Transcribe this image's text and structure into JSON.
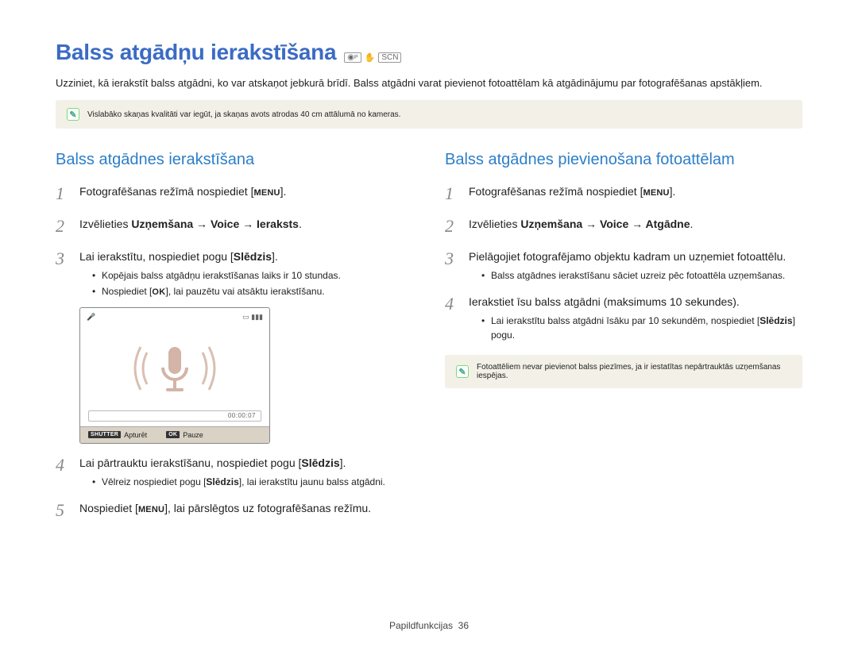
{
  "title": "Balss atgādņu ierakstīšana",
  "title_icons": {
    "p": "P",
    "hand": "✋",
    "scn": "SCN"
  },
  "intro": "Uzziniet, kā ierakstīt balss atgādni, ko var atskaņot jebkurā brīdī. Balss atgādni varat pievienot fotoattēlam kā atgādinājumu par fotografēšanas apstākļiem.",
  "tip1": "Vislabāko skaņas kvalitāti var iegūt, ja skaņas avots atrodas 40 cm attālumā no kameras.",
  "left": {
    "title": "Balss atgādnes ierakstīšana",
    "steps": {
      "s1_pre": "Fotografēšanas režīmā nospiediet [",
      "s1_menu": "MENU",
      "s1_post": "].",
      "s2_pre": "Izvēlieties ",
      "s2_bold": "Uzņemšana → Voice → Ieraksts",
      "s2_post": ".",
      "s3": "Lai ierakstītu, nospiediet pogu [",
      "s3_bold": "Slēdzis",
      "s3_post": "].",
      "s3_sub1": "Kopējais balss atgādņu ierakstīšanas laiks ir 10 stundas.",
      "s3_sub2_pre": "Nospiediet [",
      "s3_sub2_ok": "OK",
      "s3_sub2_post": "], lai pauzētu vai atsāktu ierakstīšanu.",
      "s4": "Lai pārtrauktu ierakstīšanu, nospiediet pogu [",
      "s4_bold": "Slēdzis",
      "s4_post": "].",
      "s4_sub_pre": "Vēlreiz nospiediet pogu [",
      "s4_sub_bold": "Slēdzis",
      "s4_sub_post": "], lai ierakstītu jaunu balss atgādni.",
      "s5_pre": "Nospiediet [",
      "s5_menu": "MENU",
      "s5_post": "], lai pārslēgtos uz fotografēšanas režīmu."
    },
    "screenshot": {
      "timecode": "00:00:07",
      "btn1_lab": "SHUTTER",
      "btn1_txt": "Apturēt",
      "btn2_lab": "OK",
      "btn2_txt": "Pauze"
    }
  },
  "right": {
    "title": "Balss atgādnes pievienošana fotoattēlam",
    "steps": {
      "s1_pre": "Fotografēšanas režīmā nospiediet [",
      "s1_menu": "MENU",
      "s1_post": "].",
      "s2_pre": "Izvēlieties ",
      "s2_bold": "Uzņemšana → Voice → Atgādne",
      "s2_post": ".",
      "s3": "Pielāgojiet fotografējamo objektu kadram un uzņemiet fotoattēlu.",
      "s3_sub": "Balss atgādnes ierakstīšanu sāciet uzreiz pēc fotoattēla uzņemšanas.",
      "s4": "Ierakstiet īsu balss atgādni (maksimums 10 sekundes).",
      "s4_sub_pre": "Lai ierakstītu balss atgādni īsāku par 10 sekundēm, nospiediet [",
      "s4_sub_bold": "Slēdzis",
      "s4_sub_post": "] pogu."
    },
    "tip": "Fotoattēliem nevar pievienot balss piezīmes, ja ir iestatītas nepārtrauktās uzņemšanas iespējas."
  },
  "footer": {
    "label": "Papildfunkcijas",
    "page": "36"
  }
}
